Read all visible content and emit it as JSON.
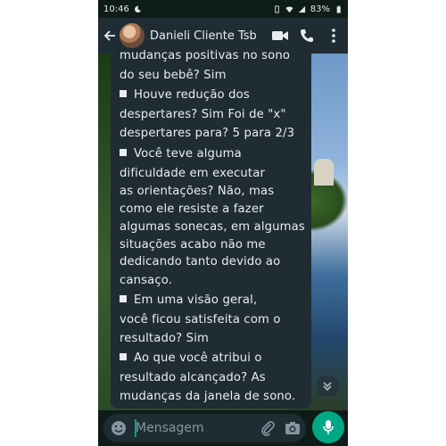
{
  "status_bar": {
    "time": "10:46",
    "battery": "83%"
  },
  "header": {
    "contact_name": "Danieli Cliente Tsb"
  },
  "message": {
    "lines": [
      {
        "text": "mudanças positivas no sono",
        "bullet": false
      },
      {
        "text": "do seu bebê? Sim",
        "bullet": false
      },
      {
        "text": "Houve redução dos",
        "bullet": true
      },
      {
        "text": "despertares? Sim Foi de \"x\"",
        "bullet": false
      },
      {
        "text": "despertares para? 5 para 2/3",
        "bullet": false
      },
      {
        "text": "Você teve alguma",
        "bullet": true
      },
      {
        "text": "dificuldade em executar",
        "bullet": false
      },
      {
        "text": "as orientações? Não, mas",
        "bullet": false
      },
      {
        "text": "como ele resiste a fazer",
        "bullet": false
      },
      {
        "text": "algumas sonecas, em algumas",
        "bullet": false
      },
      {
        "text": "situações acabo não me",
        "bullet": false
      },
      {
        "text": "dedicando tanto devido ao",
        "bullet": false
      },
      {
        "text": "cansaço.",
        "bullet": false
      },
      {
        "text": "Em uma visão geral,",
        "bullet": true
      },
      {
        "text": "você ficou satisfeita com o",
        "bullet": false
      },
      {
        "text": "resultado? Sim",
        "bullet": false
      },
      {
        "text": "Ao que você atribui o",
        "bullet": true
      },
      {
        "text": "resultado alcançado? As",
        "bullet": false
      },
      {
        "text": "mudanças  da janela de sono.",
        "bullet": false
      }
    ]
  },
  "input": {
    "placeholder": "Mensagem"
  },
  "icons": {
    "back": "arrow-left-icon",
    "video": "video-call-icon",
    "call": "phone-icon",
    "menu": "more-vertical-icon",
    "emoji": "emoji-icon",
    "attach": "paperclip-icon",
    "camera": "camera-icon",
    "mic": "microphone-icon",
    "scroll": "chevron-double-down-icon"
  },
  "colors": {
    "header_bg": "#1f2c33",
    "bubble_bg": "#1f2c33",
    "accent": "#00a884"
  }
}
